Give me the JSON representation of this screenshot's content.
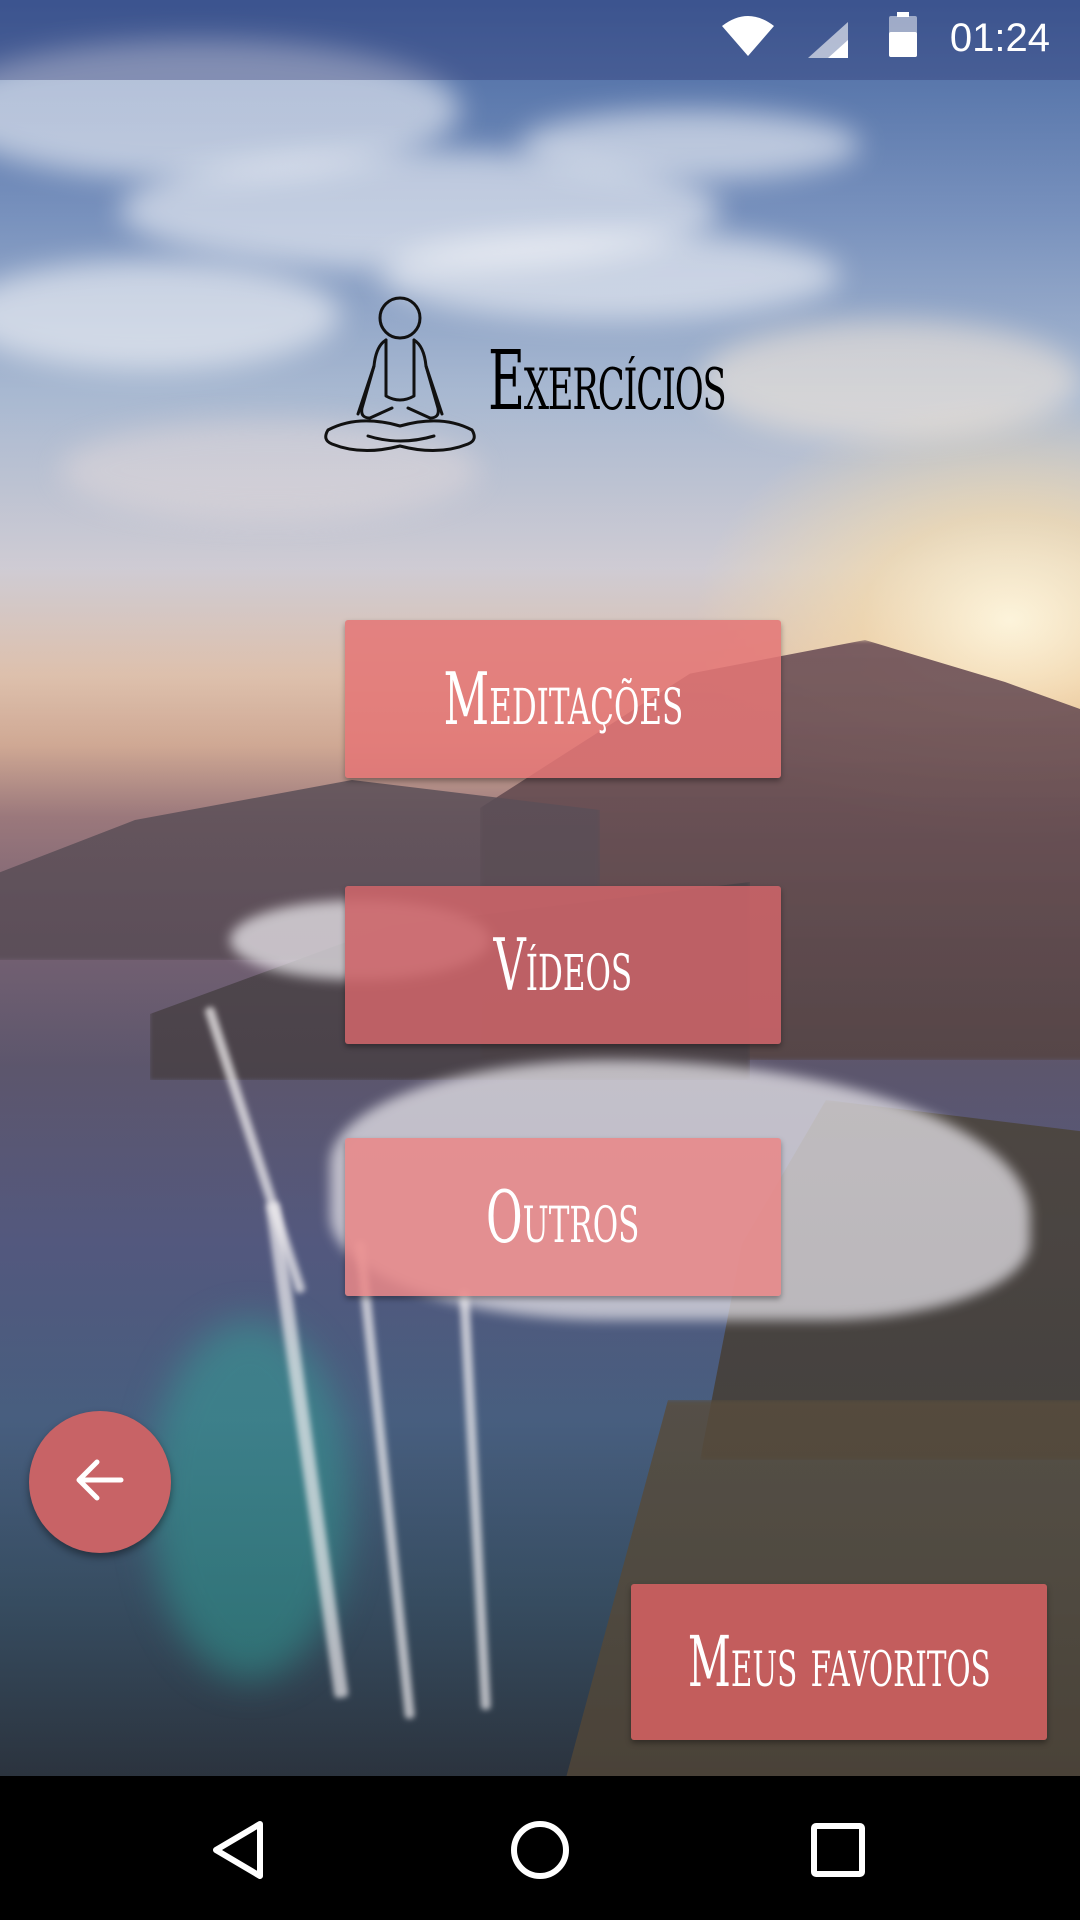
{
  "status_bar": {
    "time": "01:24",
    "icons": [
      "wifi-icon",
      "signal-icon",
      "battery-icon"
    ]
  },
  "header": {
    "icon": "meditation-person-icon",
    "title": "Exercícios"
  },
  "menu": {
    "items": [
      {
        "label": "Meditações"
      },
      {
        "label": "Vídeos"
      },
      {
        "label": "Outros"
      }
    ]
  },
  "fab": {
    "icon": "arrow-left-icon"
  },
  "favorites": {
    "label": "Meus favoritos"
  },
  "nav_bar": {
    "icons": [
      "back-triangle-icon",
      "home-circle-icon",
      "recents-square-icon"
    ]
  },
  "colors": {
    "button": "#e27070",
    "fab": "#c86366",
    "title": "#000000",
    "button_text": "#ffffff"
  }
}
